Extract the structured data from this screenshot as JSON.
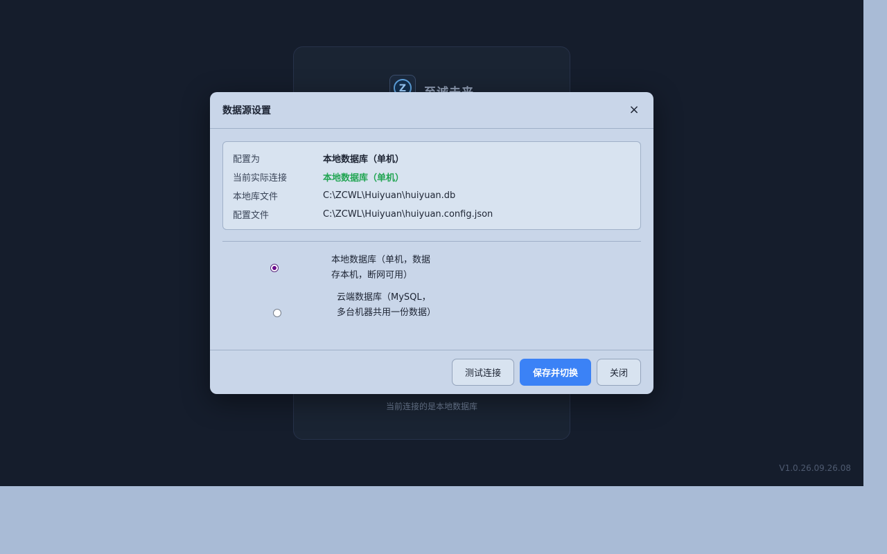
{
  "background_card": {
    "brand_name": "至诚未来",
    "hint": "当前连接的是本地数据库"
  },
  "version": "V1.0.26.09.26.08",
  "dialog": {
    "title": "数据源设置",
    "close_symbol": "×",
    "info": [
      {
        "label": "配置为",
        "value": "本地数据库（单机）"
      },
      {
        "label": "当前实际连接",
        "value": "本地数据库（单机）"
      },
      {
        "label": "本地库文件",
        "value": "C:\\ZCWL\\Huiyuan\\huiyuan.db"
      },
      {
        "label": "配置文件",
        "value": "C:\\ZCWL\\Huiyuan\\huiyuan.config.json"
      }
    ],
    "options": [
      {
        "label": "本地数据库（单机，数据存本机，断网可用）",
        "checked": true
      },
      {
        "label": "云端数据库（MySQL，多台机器共用一份数据）",
        "checked": false
      }
    ],
    "buttons": {
      "test": "测试连接",
      "save": "保存并切换",
      "close": "关闭"
    }
  },
  "colors": {
    "primary": "#3b82f6",
    "connected_green": "#22a553",
    "radio_checked": "#6a0d8e"
  }
}
